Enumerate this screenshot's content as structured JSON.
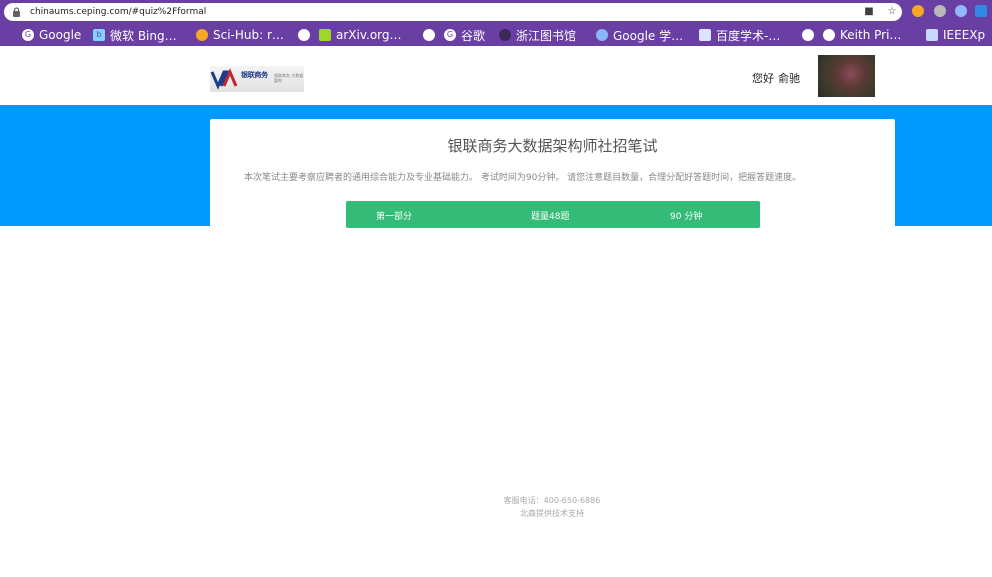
{
  "browser": {
    "url": "chinaums.ceping.com/#quiz%2Fformal",
    "bookmarks": [
      {
        "label": "Google",
        "icon": "google-icon"
      },
      {
        "label": "微软 Bing…",
        "icon": "bing-icon"
      },
      {
        "label": "Sci-Hub: r…",
        "icon": "scihub-icon"
      },
      {
        "label": "arXiv.org…",
        "icon": "arxiv-icon"
      },
      {
        "label": "谷歌",
        "icon": "globe-icon"
      },
      {
        "label": "浙江图书馆",
        "icon": "library-icon"
      },
      {
        "label": "Google 学…",
        "icon": "scholar-icon"
      },
      {
        "label": "百度学术-…",
        "icon": "baidu-icon"
      },
      {
        "label": "Keith Pri…",
        "icon": "globe-icon"
      },
      {
        "label": "IEEEXp",
        "icon": "ieee-icon"
      }
    ]
  },
  "header": {
    "logo_text": "银联商务",
    "logo_subtext": "银联商务 大数据架构",
    "greeting": "您好",
    "username": "俞驰"
  },
  "card": {
    "title": "银联商务大数据架构师社招笔试",
    "description": "本次笔试主要考察应聘者的通用综合能力及专业基础能力。 考试时间为90分钟。 请您注意题目数量，合理分配好答题时间，把握答题速度。",
    "part": {
      "name": "第一部分",
      "questions": "题量48题",
      "duration": "90 分钟"
    }
  },
  "footer": {
    "phone": "客服电话：400-650-6886",
    "support": "北森提供技术支持"
  },
  "colors": {
    "banner": "#0099ff",
    "part_bar": "#33bb77",
    "browser_chrome": "#6a3fa3"
  }
}
